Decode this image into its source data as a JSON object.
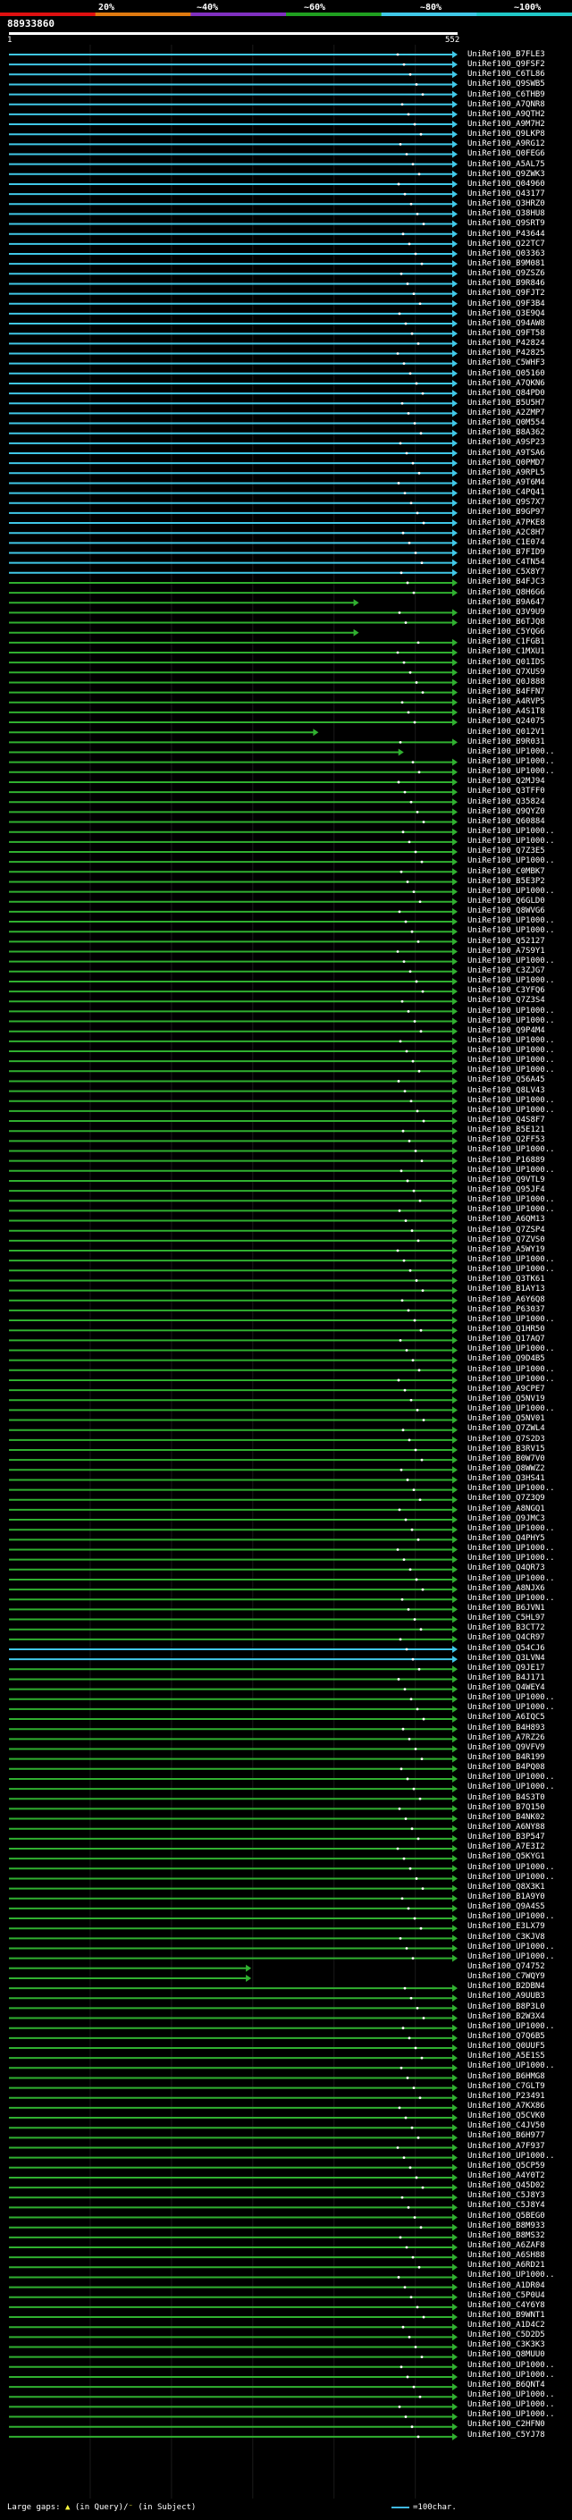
{
  "query_id": "88933860",
  "range_start": "1",
  "range_end": "552",
  "identity_scale": {
    "labels": [
      "20%",
      "~40%",
      "~60%",
      "~80%",
      "~100%"
    ],
    "colors": [
      "#e01010",
      "#e07a10",
      "#8030c0",
      "#20a020",
      "#40c8e8",
      "#20c8c8"
    ]
  },
  "colors": {
    "cyan": "#40c8e8",
    "green": "#30b030",
    "dark_green": "#1e7a1e",
    "dot": "#ffffff",
    "background": "#000000"
  },
  "hits": [
    {
      "label": "UniRef100_B7FLE3",
      "c": "cyan"
    },
    {
      "label": "UniRef100_Q9FSF2",
      "c": "cyan"
    },
    {
      "label": "UniRef100_C6TL86",
      "c": "cyan"
    },
    {
      "label": "UniRef100_Q9SWB5",
      "c": "cyan"
    },
    {
      "label": "UniRef100_C6THB9",
      "c": "cyan"
    },
    {
      "label": "UniRef100_A7QNR8",
      "c": "cyan"
    },
    {
      "label": "UniRef100_A9QTH2",
      "c": "cyan"
    },
    {
      "label": "UniRef100_A9M7H2",
      "c": "cyan"
    },
    {
      "label": "UniRef100_Q9LKP8",
      "c": "cyan"
    },
    {
      "label": "UniRef100_A9RG12",
      "c": "cyan"
    },
    {
      "label": "UniRef100_Q0FEG6",
      "c": "cyan"
    },
    {
      "label": "UniRef100_A5AL75",
      "c": "cyan"
    },
    {
      "label": "UniRef100_Q9ZWK3",
      "c": "cyan"
    },
    {
      "label": "UniRef100_Q04960",
      "c": "cyan"
    },
    {
      "label": "UniRef100_Q43177",
      "c": "cyan"
    },
    {
      "label": "UniRef100_Q3HRZ0",
      "c": "cyan"
    },
    {
      "label": "UniRef100_Q38HU8",
      "c": "cyan"
    },
    {
      "label": "UniRef100_Q9SRT9",
      "c": "cyan"
    },
    {
      "label": "UniRef100_P43644",
      "c": "cyan"
    },
    {
      "label": "UniRef100_Q22TC7",
      "c": "cyan"
    },
    {
      "label": "UniRef100_Q03363",
      "c": "cyan"
    },
    {
      "label": "UniRef100_B9M081",
      "c": "cyan"
    },
    {
      "label": "UniRef100_Q9ZSZ6",
      "c": "cyan"
    },
    {
      "label": "UniRef100_B9R846",
      "c": "cyan"
    },
    {
      "label": "UniRef100_Q9FJT2",
      "c": "cyan"
    },
    {
      "label": "UniRef100_Q9F3B4",
      "c": "cyan"
    },
    {
      "label": "UniRef100_Q3E9Q4",
      "c": "cyan"
    },
    {
      "label": "UniRef100_Q94AW8",
      "c": "cyan"
    },
    {
      "label": "UniRef100_Q9FT58",
      "c": "cyan"
    },
    {
      "label": "UniRef100_P42824",
      "c": "cyan"
    },
    {
      "label": "UniRef100_P42825",
      "c": "cyan"
    },
    {
      "label": "UniRef100_C5WHF3",
      "c": "cyan"
    },
    {
      "label": "UniRef100_Q05160",
      "c": "cyan"
    },
    {
      "label": "UniRef100_A7QKN6",
      "c": "cyan"
    },
    {
      "label": "UniRef100_Q84PD0",
      "c": "cyan"
    },
    {
      "label": "UniRef100_B5U5H7",
      "c": "cyan"
    },
    {
      "label": "UniRef100_A2ZMP7",
      "c": "cyan"
    },
    {
      "label": "UniRef100_Q0M554",
      "c": "cyan"
    },
    {
      "label": "UniRef100_B8A362",
      "c": "cyan"
    },
    {
      "label": "UniRef100_A9SP23",
      "c": "cyan"
    },
    {
      "label": "UniRef100_A9TSA6",
      "c": "cyan"
    },
    {
      "label": "UniRef100_Q0PMD7",
      "c": "cyan"
    },
    {
      "label": "UniRef100_A9RPL5",
      "c": "cyan"
    },
    {
      "label": "UniRef100_A9T6M4",
      "c": "cyan"
    },
    {
      "label": "UniRef100_C4PQ41",
      "c": "cyan"
    },
    {
      "label": "UniRef100_Q9S7X7",
      "c": "cyan"
    },
    {
      "label": "UniRef100_B9GP97",
      "c": "cyan"
    },
    {
      "label": "UniRef100_A7PKE8",
      "c": "cyan"
    },
    {
      "label": "UniRef100_A2C8H7",
      "c": "cyan"
    },
    {
      "label": "UniRef100_C1E074",
      "c": "cyan"
    },
    {
      "label": "UniRef100_B7FID9",
      "c": "cyan"
    },
    {
      "label": "UniRef100_C4TN54",
      "c": "cyan"
    },
    {
      "label": "UniRef100_C5X8Y7",
      "c": "cyan"
    },
    {
      "label": "UniRef100_B4FJC3",
      "c": "green"
    },
    {
      "label": "UniRef100_Q8H6G6",
      "c": "green"
    },
    {
      "label": "UniRef100_B9A647",
      "c": "green"
    },
    {
      "label": "UniRef100_Q3V9U9",
      "c": "green"
    },
    {
      "label": "UniRef100_B6TJQ8",
      "c": "green"
    },
    {
      "label": "UniRef100_C5YQG6",
      "c": "green"
    },
    {
      "label": "UniRef100_C1FGB1",
      "c": "green"
    },
    {
      "label": "UniRef100_C1MXU1",
      "c": "green"
    },
    {
      "label": "UniRef100_Q01IDS",
      "c": "green"
    },
    {
      "label": "UniRef100_Q7XUS9",
      "c": "green"
    },
    {
      "label": "UniRef100_Q0J888",
      "c": "green"
    },
    {
      "label": "UniRef100_B4FFN7",
      "c": "green"
    },
    {
      "label": "UniRef100_A4RVP5",
      "c": "green"
    },
    {
      "label": "UniRef100_A4S1T8",
      "c": "green"
    },
    {
      "label": "UniRef100_Q24075",
      "c": "green"
    },
    {
      "label": "UniRef100_Q012V1",
      "c": "green"
    },
    {
      "label": "UniRef100_B9R031",
      "c": "green"
    },
    {
      "label": "UniRef100_UP1000..",
      "c": "green"
    },
    {
      "label": "UniRef100_UP1000..",
      "c": "green"
    },
    {
      "label": "UniRef100_UP1000..",
      "c": "green"
    },
    {
      "label": "UniRef100_Q2MJ94",
      "c": "green"
    },
    {
      "label": "UniRef100_Q3TFF0",
      "c": "green"
    },
    {
      "label": "UniRef100_Q35824",
      "c": "green"
    },
    {
      "label": "UniRef100_Q9QYZ0",
      "c": "green"
    },
    {
      "label": "UniRef100_Q60884",
      "c": "green"
    },
    {
      "label": "UniRef100_UP1000..",
      "c": "green"
    },
    {
      "label": "UniRef100_UP1000..",
      "c": "green"
    },
    {
      "label": "UniRef100_Q7Z3E5",
      "c": "green"
    },
    {
      "label": "UniRef100_UP1000..",
      "c": "green"
    },
    {
      "label": "UniRef100_C0MBK7",
      "c": "green"
    },
    {
      "label": "UniRef100_B5E3P2",
      "c": "green"
    },
    {
      "label": "UniRef100_UP1000..",
      "c": "green"
    },
    {
      "label": "UniRef100_Q6GLD0",
      "c": "green"
    },
    {
      "label": "UniRef100_Q8WVG6",
      "c": "green"
    },
    {
      "label": "UniRef100_UP1000..",
      "c": "green"
    },
    {
      "label": "UniRef100_UP1000..",
      "c": "green"
    },
    {
      "label": "UniRef100_Q52127",
      "c": "green"
    },
    {
      "label": "UniRef100_A7S9Y1",
      "c": "green"
    },
    {
      "label": "UniRef100_UP1000..",
      "c": "green"
    },
    {
      "label": "UniRef100_C3ZJG7",
      "c": "green"
    },
    {
      "label": "UniRef100_UP1000..",
      "c": "green"
    },
    {
      "label": "UniRef100_C3YFQ6",
      "c": "green"
    },
    {
      "label": "UniRef100_Q7Z3S4",
      "c": "green"
    },
    {
      "label": "UniRef100_UP1000..",
      "c": "green"
    },
    {
      "label": "UniRef100_UP1000..",
      "c": "green"
    },
    {
      "label": "UniRef100_Q9P4M4",
      "c": "green"
    },
    {
      "label": "UniRef100_UP1000..",
      "c": "green"
    },
    {
      "label": "UniRef100_UP1000..",
      "c": "green"
    },
    {
      "label": "UniRef100_UP1000..",
      "c": "green"
    },
    {
      "label": "UniRef100_UP1000..",
      "c": "green"
    },
    {
      "label": "UniRef100_Q56A45",
      "c": "green"
    },
    {
      "label": "UniRef100_Q8LV43",
      "c": "green"
    },
    {
      "label": "UniRef100_UP1000..",
      "c": "green"
    },
    {
      "label": "UniRef100_UP1000..",
      "c": "green"
    },
    {
      "label": "UniRef100_Q4S8F7",
      "c": "green"
    },
    {
      "label": "UniRef100_B5E121",
      "c": "green"
    },
    {
      "label": "UniRef100_Q2FF53",
      "c": "green"
    },
    {
      "label": "UniRef100_UP1000..",
      "c": "green"
    },
    {
      "label": "UniRef100_P16889",
      "c": "green"
    },
    {
      "label": "UniRef100_UP1000..",
      "c": "green"
    },
    {
      "label": "UniRef100_Q9VTL9",
      "c": "green"
    },
    {
      "label": "UniRef100_Q95JF4",
      "c": "green"
    },
    {
      "label": "UniRef100_UP1000..",
      "c": "green"
    },
    {
      "label": "UniRef100_UP1000..",
      "c": "green"
    },
    {
      "label": "UniRef100_A6QM13",
      "c": "green"
    },
    {
      "label": "UniRef100_Q7ZSP4",
      "c": "green"
    },
    {
      "label": "UniRef100_Q7ZVS0",
      "c": "green"
    },
    {
      "label": "UniRef100_A5WY19",
      "c": "green"
    },
    {
      "label": "UniRef100_UP1000..",
      "c": "green"
    },
    {
      "label": "UniRef100_UP1000..",
      "c": "green"
    },
    {
      "label": "UniRef100_Q3TK61",
      "c": "green"
    },
    {
      "label": "UniRef100_B1AY13",
      "c": "green"
    },
    {
      "label": "UniRef100_A6Y6Q8",
      "c": "green"
    },
    {
      "label": "UniRef100_P63037",
      "c": "green"
    },
    {
      "label": "UniRef100_UP1000..",
      "c": "green"
    },
    {
      "label": "UniRef100_Q1HR50",
      "c": "green"
    },
    {
      "label": "UniRef100_Q17AQ7",
      "c": "green"
    },
    {
      "label": "UniRef100_UP1000..",
      "c": "green"
    },
    {
      "label": "UniRef100_Q9D4B5",
      "c": "green"
    },
    {
      "label": "UniRef100_UP1000..",
      "c": "green"
    },
    {
      "label": "UniRef100_UP1000..",
      "c": "green"
    },
    {
      "label": "UniRef100_A9CPE7",
      "c": "green"
    },
    {
      "label": "UniRef100_Q5NV19",
      "c": "green"
    },
    {
      "label": "UniRef100_UP1000..",
      "c": "green"
    },
    {
      "label": "UniRef100_Q5NV01",
      "c": "green"
    },
    {
      "label": "UniRef100_Q7ZWL4",
      "c": "green"
    },
    {
      "label": "UniRef100_Q7S2D3",
      "c": "green"
    },
    {
      "label": "UniRef100_B3RV15",
      "c": "green"
    },
    {
      "label": "UniRef100_B0W7V0",
      "c": "green"
    },
    {
      "label": "UniRef100_Q8WWZ2",
      "c": "green"
    },
    {
      "label": "UniRef100_Q3HS41",
      "c": "green"
    },
    {
      "label": "UniRef100_UP1000..",
      "c": "green"
    },
    {
      "label": "UniRef100_Q7Z3Q9",
      "c": "green"
    },
    {
      "label": "UniRef100_A8NGQ1",
      "c": "green"
    },
    {
      "label": "UniRef100_Q9JMC3",
      "c": "green"
    },
    {
      "label": "UniRef100_UP1000..",
      "c": "green"
    },
    {
      "label": "UniRef100_Q4PHY5",
      "c": "green"
    },
    {
      "label": "UniRef100_UP1000..",
      "c": "green"
    },
    {
      "label": "UniRef100_UP1000..",
      "c": "green"
    },
    {
      "label": "UniRef100_Q4QR73",
      "c": "green"
    },
    {
      "label": "UniRef100_UP1000..",
      "c": "green"
    },
    {
      "label": "UniRef100_A8NJX6",
      "c": "green"
    },
    {
      "label": "UniRef100_UP1000..",
      "c": "green"
    },
    {
      "label": "UniRef100_B6JVN1",
      "c": "green"
    },
    {
      "label": "UniRef100_C5HL97",
      "c": "green"
    },
    {
      "label": "UniRef100_B3CT72",
      "c": "green"
    },
    {
      "label": "UniRef100_Q4CR97",
      "c": "green"
    },
    {
      "label": "UniRef100_Q54CJ6",
      "c": "cyan"
    },
    {
      "label": "UniRef100_Q3LVN4",
      "c": "cyan"
    },
    {
      "label": "UniRef100_Q9JE17",
      "c": "green"
    },
    {
      "label": "UniRef100_B4J171",
      "c": "green"
    },
    {
      "label": "UniRef100_Q4WEY4",
      "c": "green"
    },
    {
      "label": "UniRef100_UP1000..",
      "c": "green"
    },
    {
      "label": "UniRef100_UP1000..",
      "c": "green"
    },
    {
      "label": "UniRef100_A6IQC5",
      "c": "green"
    },
    {
      "label": "UniRef100_B4H893",
      "c": "green"
    },
    {
      "label": "UniRef100_A7RZ26",
      "c": "green"
    },
    {
      "label": "UniRef100_Q9VFV9",
      "c": "green"
    },
    {
      "label": "UniRef100_B4R199",
      "c": "green"
    },
    {
      "label": "UniRef100_B4PQ08",
      "c": "green"
    },
    {
      "label": "UniRef100_UP1000..",
      "c": "green"
    },
    {
      "label": "UniRef100_UP1000..",
      "c": "green"
    },
    {
      "label": "UniRef100_B4S3T0",
      "c": "green"
    },
    {
      "label": "UniRef100_B7Q150",
      "c": "green"
    },
    {
      "label": "UniRef100_B4NK02",
      "c": "green"
    },
    {
      "label": "UniRef100_A6NY88",
      "c": "green"
    },
    {
      "label": "UniRef100_B3P547",
      "c": "green"
    },
    {
      "label": "UniRef100_A7E3I2",
      "c": "green"
    },
    {
      "label": "UniRef100_Q5KYG1",
      "c": "green"
    },
    {
      "label": "UniRef100_UP1000..",
      "c": "green"
    },
    {
      "label": "UniRef100_UP1000..",
      "c": "green"
    },
    {
      "label": "UniRef100_Q8X3K1",
      "c": "green"
    },
    {
      "label": "UniRef100_B1A9Y0",
      "c": "green"
    },
    {
      "label": "UniRef100_Q9A4S5",
      "c": "green"
    },
    {
      "label": "UniRef100_UP1000..",
      "c": "green"
    },
    {
      "label": "UniRef100_E3LX79",
      "c": "green"
    },
    {
      "label": "UniRef100_C3KJV8",
      "c": "green"
    },
    {
      "label": "UniRef100_UP1000..",
      "c": "green"
    },
    {
      "label": "UniRef100_UP1000..",
      "c": "green"
    },
    {
      "label": "UniRef100_Q74752",
      "c": "green"
    },
    {
      "label": "UniRef100_C7WQY9",
      "c": "green"
    },
    {
      "label": "UniRef100_B2DBN4",
      "c": "green"
    },
    {
      "label": "UniRef100_A9UUB3",
      "c": "green"
    },
    {
      "label": "UniRef100_B8P3L0",
      "c": "green"
    },
    {
      "label": "UniRef100_B2W3X4",
      "c": "green"
    },
    {
      "label": "UniRef100_UP1000..",
      "c": "green"
    },
    {
      "label": "UniRef100_Q7Q6B5",
      "c": "green"
    },
    {
      "label": "UniRef100_Q0UUF5",
      "c": "green"
    },
    {
      "label": "UniRef100_A5E1S5",
      "c": "green"
    },
    {
      "label": "UniRef100_UP1000..",
      "c": "green"
    },
    {
      "label": "UniRef100_B6HMG8",
      "c": "green"
    },
    {
      "label": "UniRef100_C7GLT9",
      "c": "green"
    },
    {
      "label": "UniRef100_P23491",
      "c": "green"
    },
    {
      "label": "UniRef100_A7KX86",
      "c": "green"
    },
    {
      "label": "UniRef100_Q5CVK0",
      "c": "green"
    },
    {
      "label": "UniRef100_C4JV50",
      "c": "green"
    },
    {
      "label": "UniRef100_B6H977",
      "c": "green"
    },
    {
      "label": "UniRef100_A7F937",
      "c": "green"
    },
    {
      "label": "UniRef100_UP1000..",
      "c": "green"
    },
    {
      "label": "UniRef100_Q5CP59",
      "c": "green"
    },
    {
      "label": "UniRef100_A4Y0T2",
      "c": "green"
    },
    {
      "label": "UniRef100_Q45D02",
      "c": "green"
    },
    {
      "label": "UniRef100_C5J8Y3",
      "c": "green"
    },
    {
      "label": "UniRef100_C5J8Y4",
      "c": "green"
    },
    {
      "label": "UniRef100_Q5BEG0",
      "c": "green"
    },
    {
      "label": "UniRef100_B8M933",
      "c": "green"
    },
    {
      "label": "UniRef100_B8MS32",
      "c": "green"
    },
    {
      "label": "UniRef100_A6ZAF8",
      "c": "green"
    },
    {
      "label": "UniRef100_A6SH88",
      "c": "green"
    },
    {
      "label": "UniRef100_A6RD21",
      "c": "green"
    },
    {
      "label": "UniRef100_UP1000..",
      "c": "green"
    },
    {
      "label": "UniRef100_A1DR04",
      "c": "green"
    },
    {
      "label": "UniRef100_C5P0U4",
      "c": "green"
    },
    {
      "label": "UniRef100_C4Y6Y8",
      "c": "green"
    },
    {
      "label": "UniRef100_B9WNT1",
      "c": "green"
    },
    {
      "label": "UniRef100_A1D4C2",
      "c": "green"
    },
    {
      "label": "UniRef100_C5D2D5",
      "c": "green"
    },
    {
      "label": "UniRef100_C3K3K3",
      "c": "green"
    },
    {
      "label": "UniRef100_Q8MUU0",
      "c": "green"
    },
    {
      "label": "UniRef100_UP1000..",
      "c": "green"
    },
    {
      "label": "UniRef100_UP1000..",
      "c": "green"
    },
    {
      "label": "UniRef100_B6QNT4",
      "c": "green"
    },
    {
      "label": "UniRef100_UP1000..",
      "c": "green"
    },
    {
      "label": "UniRef100_UP1000..",
      "c": "green"
    },
    {
      "label": "UniRef100_UP1000..",
      "c": "green"
    },
    {
      "label": "UniRef100_C2HFN0",
      "c": "green"
    },
    {
      "label": "UniRef100_C5YJ78",
      "c": "green"
    }
  ],
  "short_hits": [
    {
      "row": 55,
      "end": 0.78,
      "c": "cyan"
    },
    {
      "row": 58,
      "end": 0.78,
      "c": "cyan"
    },
    {
      "row": 68,
      "end": 0.69,
      "c": "cyan"
    },
    {
      "row": 70,
      "end": 0.88,
      "c": "cyan"
    },
    {
      "row": 192,
      "end": 0.54,
      "c": "cyan"
    },
    {
      "row": 193,
      "end": 0.54,
      "c": "cyan"
    }
  ],
  "footer": {
    "legend_text": "Large gaps:",
    "gap_query": "(in Query)",
    "gap_sep": "/",
    "gap_subject": "(in Subject)",
    "scale_text": "=100char."
  }
}
